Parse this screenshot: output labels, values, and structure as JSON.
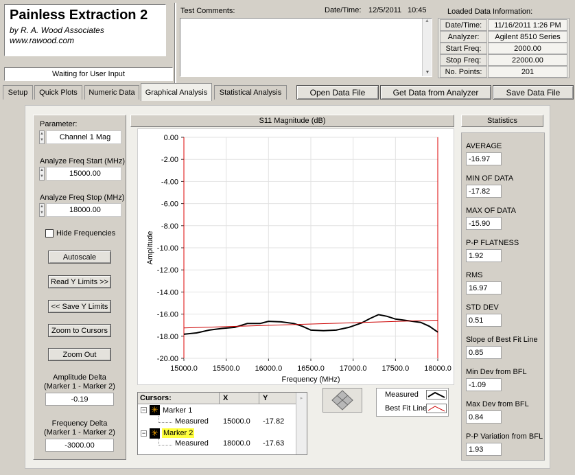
{
  "app": {
    "title": "Painless Extraction 2",
    "company": "by R. A. Wood Associates",
    "url": "www.rawood.com",
    "status": "Waiting for User Input"
  },
  "comments": {
    "label": "Test Comments:",
    "datetime_label": "Date/Time:",
    "date": "12/5/2011",
    "time": "10:45"
  },
  "loaded": {
    "title": "Loaded Data Information:",
    "rows": [
      {
        "k": "Date/Time:",
        "v": "11/16/2011  1:26 PM"
      },
      {
        "k": "Analyzer:",
        "v": "Agilent 8510 Series"
      },
      {
        "k": "Start Freq:",
        "v": "2000.00"
      },
      {
        "k": "Stop Freq:",
        "v": "22000.00"
      },
      {
        "k": "No. Points:",
        "v": "201"
      }
    ]
  },
  "tabs": [
    "Setup",
    "Quick Plots",
    "Numeric Data",
    "Graphical Analysis",
    "Statistical Analysis"
  ],
  "actions": {
    "open": "Open Data File",
    "get": "Get Data from Analyzer",
    "save": "Save Data File"
  },
  "left": {
    "param_label": "Parameter:",
    "param_value": "Channel 1 Mag",
    "start_label": "Analyze Freq Start (MHz)",
    "start_value": "15000.00",
    "stop_label": "Analyze Freq Stop (MHz)",
    "stop_value": "18000.00",
    "hide_label": "Hide Frequencies",
    "buttons": [
      "Autoscale",
      "Read Y Limits >>",
      "<< Save Y Limits",
      "Zoom to Cursors",
      "Zoom Out"
    ],
    "amp_delta_label1": "Amplitude Delta",
    "amp_delta_label2": "(Marker 1 - Marker 2)",
    "amp_delta_value": "-0.19",
    "freq_delta_label1": "Frequency Delta",
    "freq_delta_label2": "(Marker 1 - Marker 2)",
    "freq_delta_value": "-3000.00"
  },
  "cursors": {
    "header": [
      "Cursors:",
      "X",
      "Y"
    ],
    "rows": [
      {
        "marker": "Marker 1",
        "sub": "Measured",
        "x": "15000.0",
        "y": "-17.82"
      },
      {
        "marker": "Marker 2",
        "sub": "Measured",
        "x": "18000.0",
        "y": "-17.63"
      }
    ]
  },
  "legend": {
    "measured": "Measured",
    "bfl": "Best Fit Line"
  },
  "stats": {
    "title": "Statistics",
    "items": [
      {
        "k": "AVERAGE",
        "v": "-16.97"
      },
      {
        "k": "MIN OF DATA",
        "v": "-17.82"
      },
      {
        "k": "MAX OF DATA",
        "v": "-15.90"
      },
      {
        "k": "P-P FLATNESS",
        "v": "1.92"
      },
      {
        "k": "RMS",
        "v": "16.97"
      },
      {
        "k": "STD DEV",
        "v": "0.51"
      },
      {
        "k": "Slope of Best Fit Line",
        "v": "0.85"
      },
      {
        "k": "Min Dev from BFL",
        "v": "-1.09"
      },
      {
        "k": "Max Dev from BFL",
        "v": "0.84"
      },
      {
        "k": "P-P Variation from BFL",
        "v": "1.93"
      }
    ]
  },
  "chart_data": {
    "type": "line",
    "title": "S11 Magnitude (dB)",
    "xlabel": "Frequency (MHz)",
    "ylabel": "Amplitude",
    "xlim": [
      15000,
      18000
    ],
    "ylim": [
      -20,
      0
    ],
    "xticks": [
      "15000.0",
      "15500.0",
      "16000.0",
      "16500.0",
      "17000.0",
      "17500.0",
      "18000.0"
    ],
    "yticks": [
      "0.00",
      "-2.00",
      "-4.00",
      "-6.00",
      "-8.00",
      "-10.00",
      "-12.00",
      "-14.00",
      "-16.00",
      "-18.00",
      "-20.00"
    ],
    "grid": true,
    "cursor_x": [
      15000,
      18000
    ],
    "series": [
      {
        "name": "Measured",
        "color": "#000000",
        "x": [
          15000,
          15150,
          15300,
          15450,
          15600,
          15750,
          15900,
          16000,
          16150,
          16300,
          16400,
          16500,
          16650,
          16800,
          16950,
          17100,
          17200,
          17300,
          17400,
          17500,
          17650,
          17800,
          17900,
          18000
        ],
        "y": [
          -17.82,
          -17.7,
          -17.45,
          -17.3,
          -17.2,
          -16.85,
          -16.85,
          -16.65,
          -16.7,
          -16.85,
          -17.1,
          -17.45,
          -17.5,
          -17.45,
          -17.2,
          -16.8,
          -16.4,
          -16.05,
          -16.2,
          -16.45,
          -16.6,
          -16.75,
          -17.1,
          -17.63
        ]
      },
      {
        "name": "Best Fit Line",
        "color": "#cc0000",
        "x": [
          15000,
          18000
        ],
        "y": [
          -17.25,
          -16.55
        ]
      }
    ]
  }
}
